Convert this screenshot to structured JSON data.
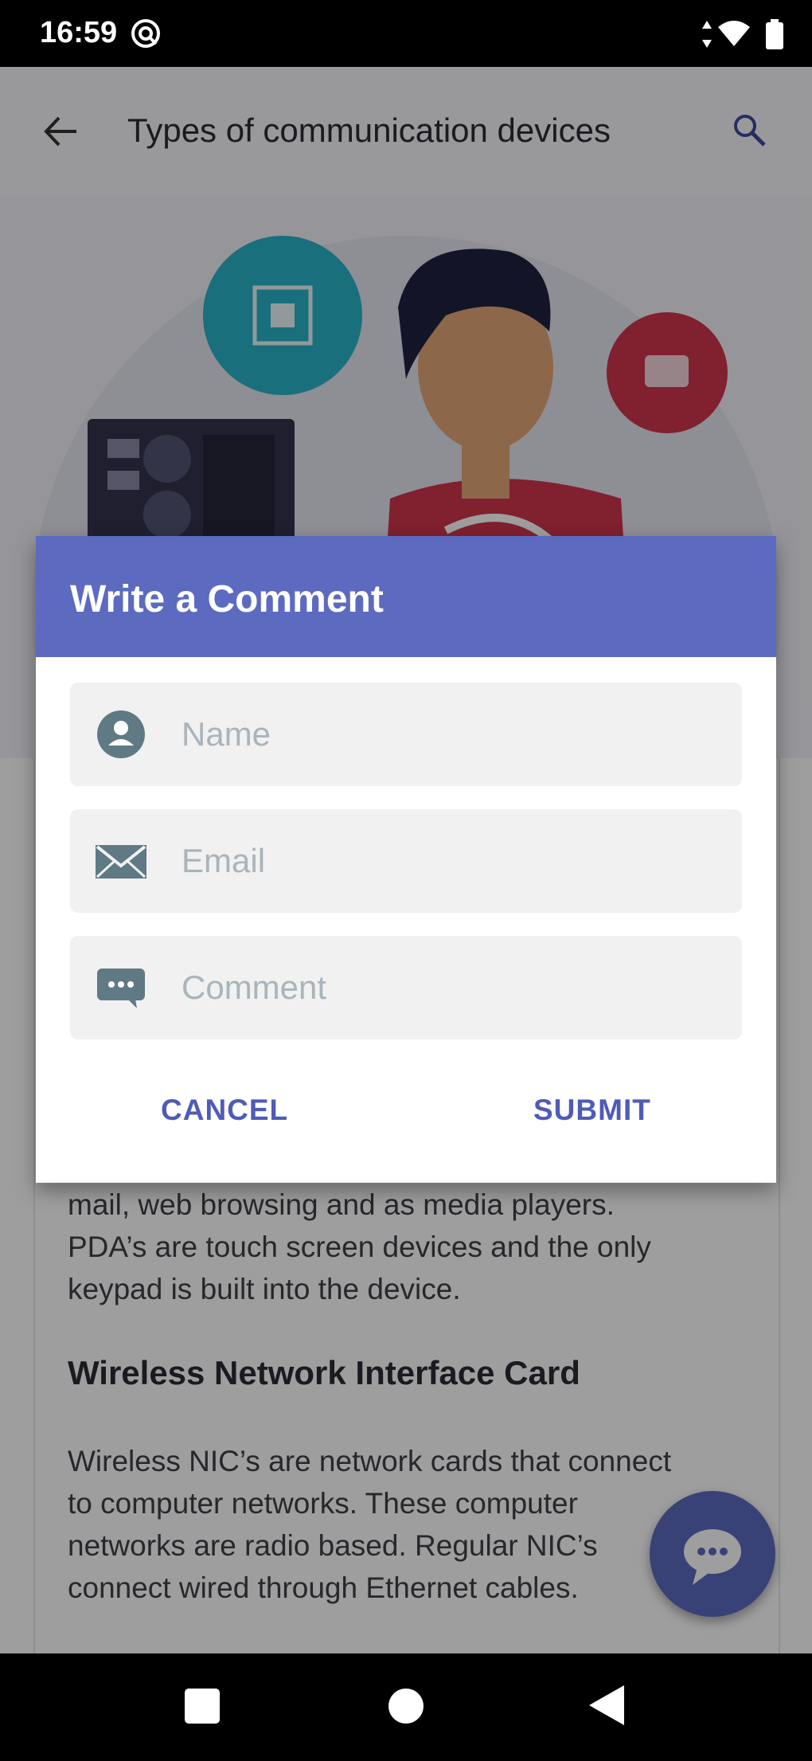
{
  "status_bar": {
    "time": "16:59"
  },
  "app_bar": {
    "title": "Types of communication devices"
  },
  "article": {
    "paragraph1_lines": [
      "mail, web browsing and as media players.",
      "PDA’s are touch screen devices and the only",
      "keypad is built into the device."
    ],
    "heading": "Wireless Network Interface Card",
    "paragraph2_lines": [
      "Wireless NIC’s are network cards that connect",
      "to computer networks. These computer",
      "networks are radio based. Regular NIC’s",
      "connect wired through Ethernet cables."
    ]
  },
  "dialog": {
    "title": "Write a Comment",
    "fields": {
      "name": {
        "placeholder": "Name",
        "value": "",
        "icon": "person-icon"
      },
      "email": {
        "placeholder": "Email",
        "value": "",
        "icon": "envelope-icon"
      },
      "comment": {
        "placeholder": "Comment",
        "value": "",
        "icon": "chat-icon"
      }
    },
    "cancel_label": "CANCEL",
    "submit_label": "SUBMIT"
  },
  "colors": {
    "accent": "#5c6bc0",
    "button_text": "#4f5bb8",
    "field_bg": "#f1f1f1",
    "icon": "#5f7a85"
  }
}
